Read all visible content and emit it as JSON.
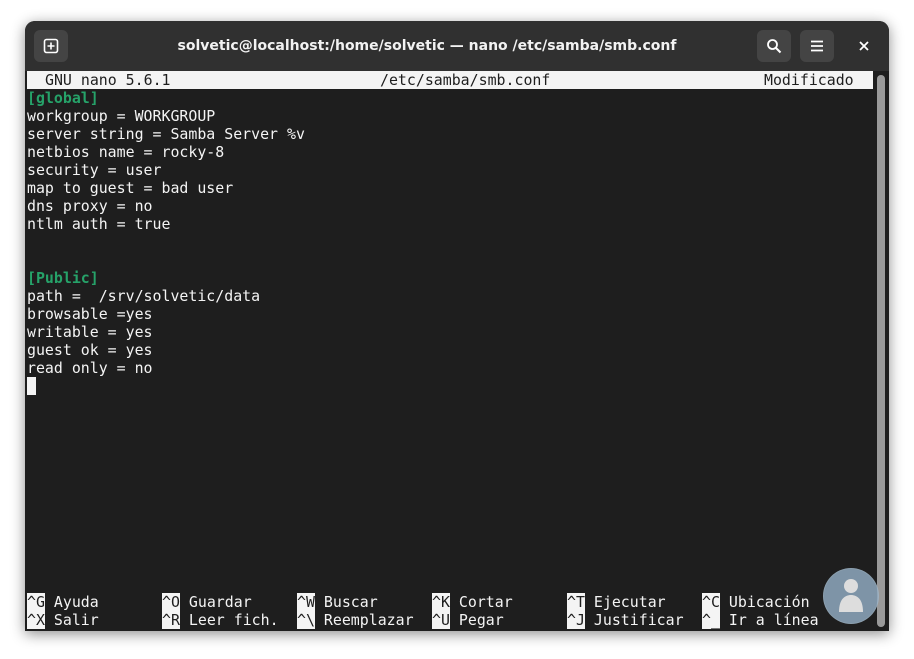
{
  "window": {
    "title": "solvetic@localhost:/home/solvetic — nano /etc/samba/smb.conf",
    "buttons": {
      "new_tab_icon": "new-tab-icon",
      "search_icon": "search-icon",
      "menu_icon": "hamburger-menu-icon",
      "close_icon": "close-icon"
    }
  },
  "nano": {
    "version": "GNU nano 5.6.1",
    "filename": "/etc/samba/smb.conf",
    "status": "Modificado"
  },
  "file": {
    "lines": [
      "[global]",
      "workgroup = WORKGROUP",
      "server string = Samba Server %v",
      "netbios name = rocky-8",
      "security = user",
      "map to guest = bad user",
      "dns proxy = no",
      "ntlm auth = true",
      "",
      "",
      "[Public]",
      "path =  /srv/solvetic/data",
      "browsable =yes",
      "writable = yes",
      "guest ok = yes",
      "read only = no"
    ]
  },
  "shortcuts": {
    "row1": [
      {
        "key": "^G",
        "label": "Ayuda"
      },
      {
        "key": "^O",
        "label": "Guardar"
      },
      {
        "key": "^W",
        "label": "Buscar"
      },
      {
        "key": "^K",
        "label": "Cortar"
      },
      {
        "key": "^T",
        "label": "Ejecutar"
      },
      {
        "key": "^C",
        "label": "Ubicación"
      }
    ],
    "row2": [
      {
        "key": "^X",
        "label": "Salir"
      },
      {
        "key": "^R",
        "label": "Leer fich."
      },
      {
        "key": "^\\",
        "label": "Reemplazar"
      },
      {
        "key": "^U",
        "label": "Pegar"
      },
      {
        "key": "^J",
        "label": "Justificar"
      },
      {
        "key": "^_",
        "label": "Ir a línea"
      }
    ]
  },
  "colors": {
    "terminal_bg": "#1e1e1e",
    "terminal_fg": "#f4f4f4",
    "section_header": "#26a269",
    "titlebar_bg": "#303030"
  }
}
